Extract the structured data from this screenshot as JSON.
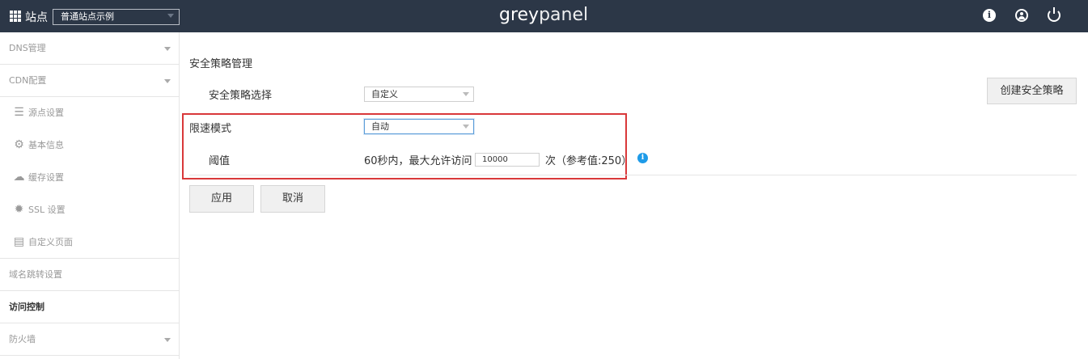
{
  "header": {
    "site_label": "站点",
    "site_select_value": "普通站点示例",
    "logo_main": "grey",
    "logo_thin": "panel"
  },
  "sidebar": {
    "items": [
      {
        "label": "DNS管理"
      },
      {
        "label": "CDN配置"
      },
      {
        "label": "源点设置",
        "icon": "server-icon"
      },
      {
        "label": "基本信息",
        "icon": "gear-icon"
      },
      {
        "label": "缓存设置",
        "icon": "cloud-download-icon"
      },
      {
        "label": "SSL 设置",
        "icon": "badge-icon"
      },
      {
        "label": "自定义页面",
        "icon": "custom-page-icon"
      },
      {
        "label": "域名跳转设置"
      },
      {
        "label": "访问控制",
        "active": true
      },
      {
        "label": "防火墙"
      }
    ]
  },
  "main": {
    "title": "安全策略管理",
    "policy_label": "安全策略选择",
    "policy_value": "自定义",
    "create_button": "创建安全策略",
    "rate_mode_label": "限速模式",
    "rate_mode_value": "自动",
    "threshold_label": "阈值",
    "threshold_prefix": "60秒内，最大允许访问",
    "threshold_value": "10000",
    "threshold_suffix": "次（参考值:250）",
    "apply_button": "应用",
    "cancel_button": "取消"
  },
  "colors": {
    "topbar": "#2c3747",
    "highlight": "#d9383a",
    "info": "#1e9be8"
  }
}
